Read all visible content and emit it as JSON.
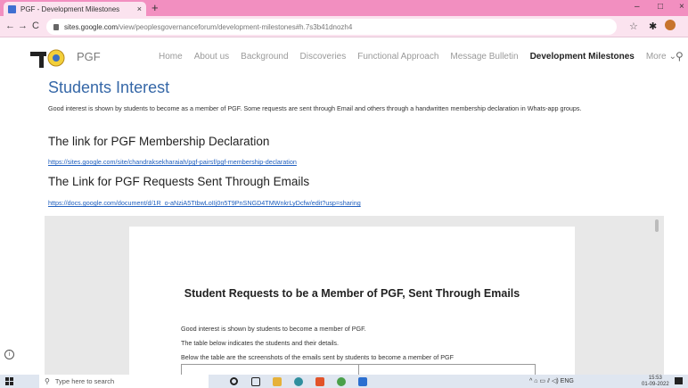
{
  "browser": {
    "tab_title": "PGF - Development Milestones",
    "tab_close": "×",
    "new_tab": "+",
    "url_host": "sites.google.com",
    "url_path": "/view/peoplesgovernanceforum/development-milestones#h.7s3b41dnozh4",
    "nav_back": "←",
    "nav_forward": "→",
    "reload": "C",
    "min": "–",
    "max": "□",
    "close": "×",
    "star": "☆",
    "puzzle": "✱"
  },
  "site": {
    "name": "PGF",
    "nav": [
      "Home",
      "About us",
      "Background",
      "Discoveries",
      "Functional Approach",
      "Message Bulletin",
      "Development Milestones",
      "More"
    ],
    "active_nav_index": 6,
    "more_chevron": "⌄",
    "search_icon": "⚲"
  },
  "content": {
    "heading_interest": "Students Interest",
    "para_interest": "Good interest is shown by students to become as a member of PGF. Some requests are sent through Email and others through a handwritten membership declaration in Whats-app groups.",
    "heading_link1": "The link for PGF Membership Declaration",
    "link1": "https://sites.google.com/site/chandraksekharaiah/pgf-pairsf/pgf-membership-declaration",
    "heading_link2": "The Link for PGF Requests Sent Through Emails",
    "link2": "https://docs.google.com/document/d/1R_o-aNziA5TtbwLoIIj0n5T9PnSNGD4TMWnkrLyDcfw/edit?usp=sharing"
  },
  "doc": {
    "title": "Student Requests to be a Member of PGF, Sent Through Emails",
    "line1": "Good interest is shown by students to become a member of PGF.",
    "line2": "The table below indicates the students and their details.",
    "line3": "Below the table are the screenshots of the emails sent by students to become a member of PGF"
  },
  "taskbar": {
    "search_placeholder": "Type here to search",
    "search_icon": "⚲",
    "tray_text": "^ ⌂ ▭ ⫽ ◁) ENG",
    "time": "15:53",
    "date": "01-09-2022"
  },
  "info_icon": "i",
  "colors": {
    "tabstrip": "#f28fc0",
    "address_bg": "#fbe3ef",
    "heading_blue": "#3567a7",
    "link_blue": "#1f5fbf"
  }
}
